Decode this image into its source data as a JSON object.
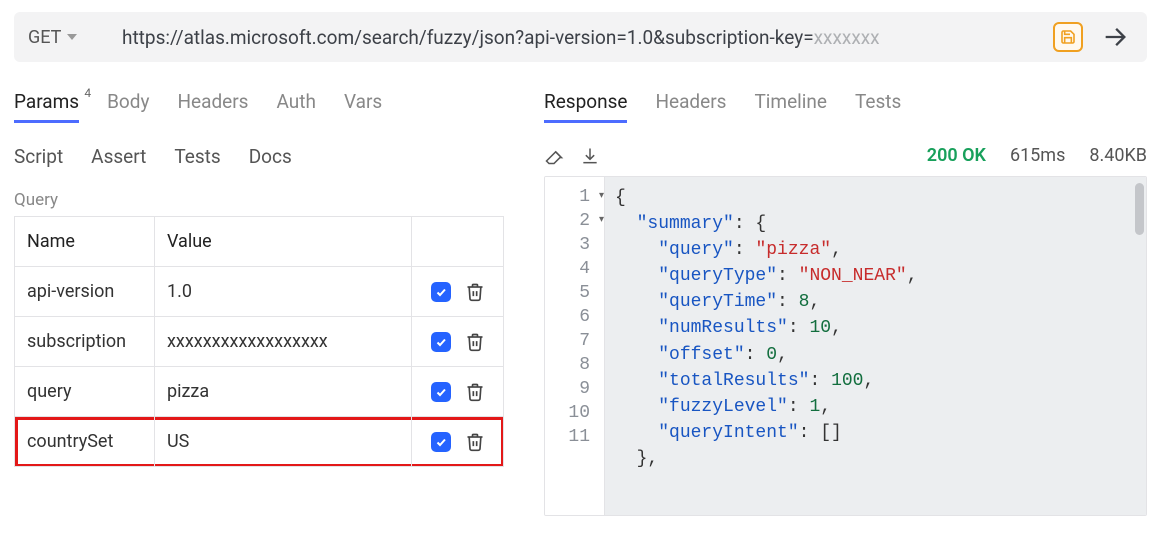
{
  "request": {
    "method": "GET",
    "url_prefix": "https://atlas.microsoft.com/search/fuzzy/json?api-version=1.0&subscription-key=",
    "url_masked": "xxxxxxx"
  },
  "left_tabs": {
    "params_label": "Params",
    "params_count": "4",
    "body_label": "Body",
    "headers_label": "Headers",
    "auth_label": "Auth",
    "vars_label": "Vars"
  },
  "left_subtabs": {
    "script": "Script",
    "assert": "Assert",
    "tests": "Tests",
    "docs": "Docs"
  },
  "query_section_label": "Query",
  "query_headers": {
    "name": "Name",
    "value": "Value"
  },
  "query_rows": [
    {
      "name": "api-version",
      "value": "1.0",
      "checked": true,
      "highlight": false
    },
    {
      "name": "subscription",
      "value": "xxxxxxxxxxxxxxxxxx",
      "checked": true,
      "highlight": false
    },
    {
      "name": "query",
      "value": "pizza",
      "checked": true,
      "highlight": false
    },
    {
      "name": "countrySet",
      "value": "US",
      "checked": true,
      "highlight": true
    }
  ],
  "right_tabs": {
    "response": "Response",
    "headers": "Headers",
    "timeline": "Timeline",
    "tests": "Tests"
  },
  "response_meta": {
    "status": "200 OK",
    "time": "615ms",
    "size": "8.40KB"
  },
  "response_body": {
    "summary": {
      "query": "pizza",
      "queryType": "NON_NEAR",
      "queryTime": 8,
      "numResults": 10,
      "offset": 0,
      "totalResults": 100,
      "fuzzyLevel": 1,
      "queryIntent": []
    }
  },
  "code_lines": [
    {
      "n": 1,
      "fold": true,
      "indent": 0,
      "tokens": [
        {
          "t": "p",
          "v": "{"
        }
      ]
    },
    {
      "n": 2,
      "fold": true,
      "indent": 1,
      "tokens": [
        {
          "t": "k",
          "v": "\"summary\""
        },
        {
          "t": "p",
          "v": ": {"
        }
      ]
    },
    {
      "n": 3,
      "fold": false,
      "indent": 2,
      "tokens": [
        {
          "t": "k",
          "v": "\"query\""
        },
        {
          "t": "p",
          "v": ": "
        },
        {
          "t": "s",
          "v": "\"pizza\""
        },
        {
          "t": "p",
          "v": ","
        }
      ]
    },
    {
      "n": 4,
      "fold": false,
      "indent": 2,
      "tokens": [
        {
          "t": "k",
          "v": "\"queryType\""
        },
        {
          "t": "p",
          "v": ": "
        },
        {
          "t": "s",
          "v": "\"NON_NEAR\""
        },
        {
          "t": "p",
          "v": ","
        }
      ]
    },
    {
      "n": 5,
      "fold": false,
      "indent": 2,
      "tokens": [
        {
          "t": "k",
          "v": "\"queryTime\""
        },
        {
          "t": "p",
          "v": ": "
        },
        {
          "t": "n",
          "v": "8"
        },
        {
          "t": "p",
          "v": ","
        }
      ]
    },
    {
      "n": 6,
      "fold": false,
      "indent": 2,
      "tokens": [
        {
          "t": "k",
          "v": "\"numResults\""
        },
        {
          "t": "p",
          "v": ": "
        },
        {
          "t": "n",
          "v": "10"
        },
        {
          "t": "p",
          "v": ","
        }
      ]
    },
    {
      "n": 7,
      "fold": false,
      "indent": 2,
      "tokens": [
        {
          "t": "k",
          "v": "\"offset\""
        },
        {
          "t": "p",
          "v": ": "
        },
        {
          "t": "n",
          "v": "0"
        },
        {
          "t": "p",
          "v": ","
        }
      ]
    },
    {
      "n": 8,
      "fold": false,
      "indent": 2,
      "tokens": [
        {
          "t": "k",
          "v": "\"totalResults\""
        },
        {
          "t": "p",
          "v": ": "
        },
        {
          "t": "n",
          "v": "100"
        },
        {
          "t": "p",
          "v": ","
        }
      ]
    },
    {
      "n": 9,
      "fold": false,
      "indent": 2,
      "tokens": [
        {
          "t": "k",
          "v": "\"fuzzyLevel\""
        },
        {
          "t": "p",
          "v": ": "
        },
        {
          "t": "n",
          "v": "1"
        },
        {
          "t": "p",
          "v": ","
        }
      ]
    },
    {
      "n": 10,
      "fold": false,
      "indent": 2,
      "tokens": [
        {
          "t": "k",
          "v": "\"queryIntent\""
        },
        {
          "t": "p",
          "v": ": []"
        }
      ]
    },
    {
      "n": 11,
      "fold": false,
      "indent": 1,
      "tokens": [
        {
          "t": "p",
          "v": "},"
        }
      ]
    }
  ]
}
